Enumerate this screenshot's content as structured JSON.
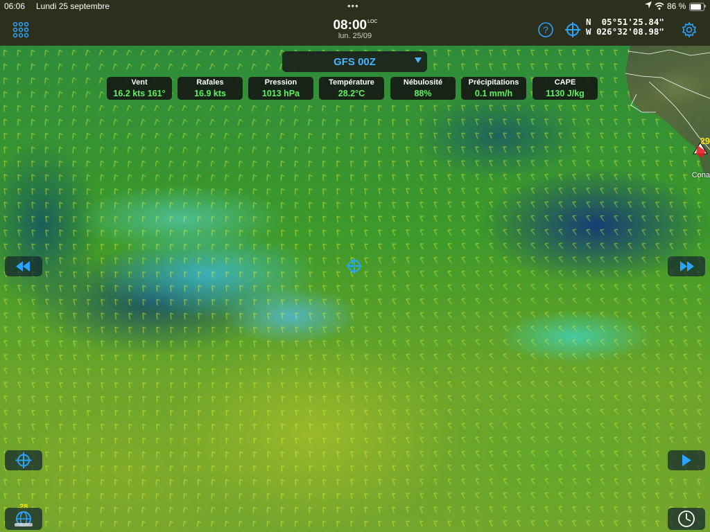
{
  "status_bar": {
    "time": "06:06",
    "date": "Lundi 25 septembre",
    "battery_percent": "86 %",
    "battery_level": 0.86,
    "icons": [
      "location-arrow-icon",
      "wifi-icon",
      "battery-icon"
    ]
  },
  "toolbar": {
    "menu_icon": "grid-menu-icon",
    "time": "08:00",
    "time_suffix": "LOC",
    "subdate": "lun. 25/09",
    "help_icon": "help-icon",
    "position_icon": "crosshair-icon",
    "lat_hemi": "N",
    "lat": "05°51'25.84\"",
    "lon_hemi": "W",
    "lon": "026°32'08.98\"",
    "settings_icon": "gear-icon"
  },
  "model": {
    "label": "GFS 00Z"
  },
  "chips": [
    {
      "label": "Vent",
      "value": "16.2 kts 161°"
    },
    {
      "label": "Rafales",
      "value": "16.9 kts"
    },
    {
      "label": "Pression",
      "value": "1013 hPa"
    },
    {
      "label": "Température",
      "value": "28.2°C"
    },
    {
      "label": "Nébulosité",
      "value": "88%"
    },
    {
      "label": "Précipitations",
      "value": "0.1 mm/h"
    },
    {
      "label": "CAPE",
      "value": "1130 J/kg"
    }
  ],
  "map": {
    "city_temp": "29",
    "city_name": "Cona",
    "layers_temp": "28",
    "barb_color": "#d9f23a",
    "accent": "#47b6ff",
    "value_color": "#5df35d"
  },
  "controls": {
    "rewind_icon": "rewind-icon",
    "fast_forward_icon": "fast-forward-icon",
    "locate_icon": "crosshair-icon",
    "play_icon": "play-icon",
    "layers_icon": "globe-layers-icon",
    "clock_icon": "clock-icon"
  }
}
